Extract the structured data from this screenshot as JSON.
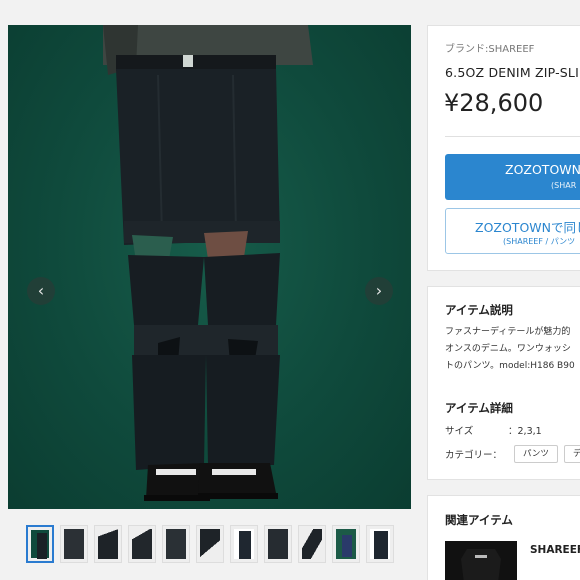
{
  "gallery": {
    "prev_label": "‹",
    "next_label": "›",
    "thumbnail_count": 11
  },
  "product": {
    "brand": "ブランド:SHAREEF",
    "name": "6.5OZ DENIM ZIP-SLI",
    "price": "¥28,600"
  },
  "buttons": {
    "primary": {
      "label": "ZOZOTOWN",
      "sub": "(SHAR"
    },
    "secondary": {
      "label": "ZOZOTOWNで同じ",
      "sub": "(SHAREEF / パンツ"
    }
  },
  "description": {
    "title": "アイテム説明",
    "lines": [
      "ファスナーディテールが魅力的",
      "オンスのデニム。ワンウォッシ",
      "トのパンツ。model:H186 B90"
    ]
  },
  "details": {
    "title": "アイテム詳細",
    "size_label": "サイズ",
    "size_value": "：2,3,1",
    "category_label": "カテゴリー：",
    "category_tags": [
      "パンツ",
      "デ"
    ]
  },
  "related": {
    "title": "関連アイテム",
    "item_name": "SHAREEF",
    "item_thumb_text": "SHAREEF"
  },
  "colors": {
    "accent": "#2b86cf",
    "photo_bg": "#0f4a3c"
  }
}
